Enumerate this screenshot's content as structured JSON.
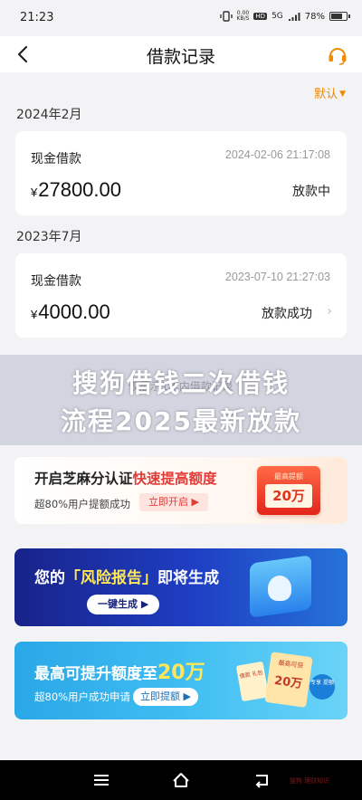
{
  "status": {
    "time": "21:23",
    "net_speed_value": "0.00",
    "net_speed_unit": "KB/S",
    "hd": "HD",
    "signal": "5G",
    "battery": "78%",
    "battery_level": 0.78
  },
  "nav": {
    "title": "借款记录"
  },
  "filter": {
    "label": "默认"
  },
  "records": [
    {
      "month": "2024年2月",
      "type": "现金借款",
      "date": "2024-02-06 21:17:08",
      "currency": "¥",
      "amount": "27800.00",
      "status": "放款中"
    },
    {
      "month": "2023年7月",
      "type": "现金借款",
      "date": "2023-07-10 21:27:03",
      "currency": "¥",
      "amount": "4000.00",
      "status": "放款成功"
    }
  ],
  "hint": "仅展示1年内借款记录",
  "overlay": {
    "line1": "搜狗借钱二次借钱",
    "line2": "流程2025最新放款"
  },
  "banners": [
    {
      "title_prefix": "开启芝麻分认证",
      "title_highlight": "快速提高额度",
      "subtitle": "超80%用户提额成功",
      "button": "立即开启 ▶",
      "coupon_top": "最高提额",
      "coupon_value": "20万"
    },
    {
      "title_prefix": "您的",
      "title_highlight": "「风险报告」",
      "title_suffix": "即将生成",
      "button": "一键生成 ▶"
    },
    {
      "title_prefix": "最高可提升额度至",
      "title_highlight": "20万",
      "subtitle": "超80%用户成功申请",
      "button": "立即提额 ▶",
      "coupon_top": "最高可获",
      "coupon_value": "20万",
      "coupon_small": "借款 礼包",
      "badge": "专享 提额"
    }
  ],
  "watermark": "搜狗·理财知识",
  "colors": {
    "accent": "#f08a00",
    "red": "#e23a36",
    "highlight_yellow": "#ffe75a"
  }
}
